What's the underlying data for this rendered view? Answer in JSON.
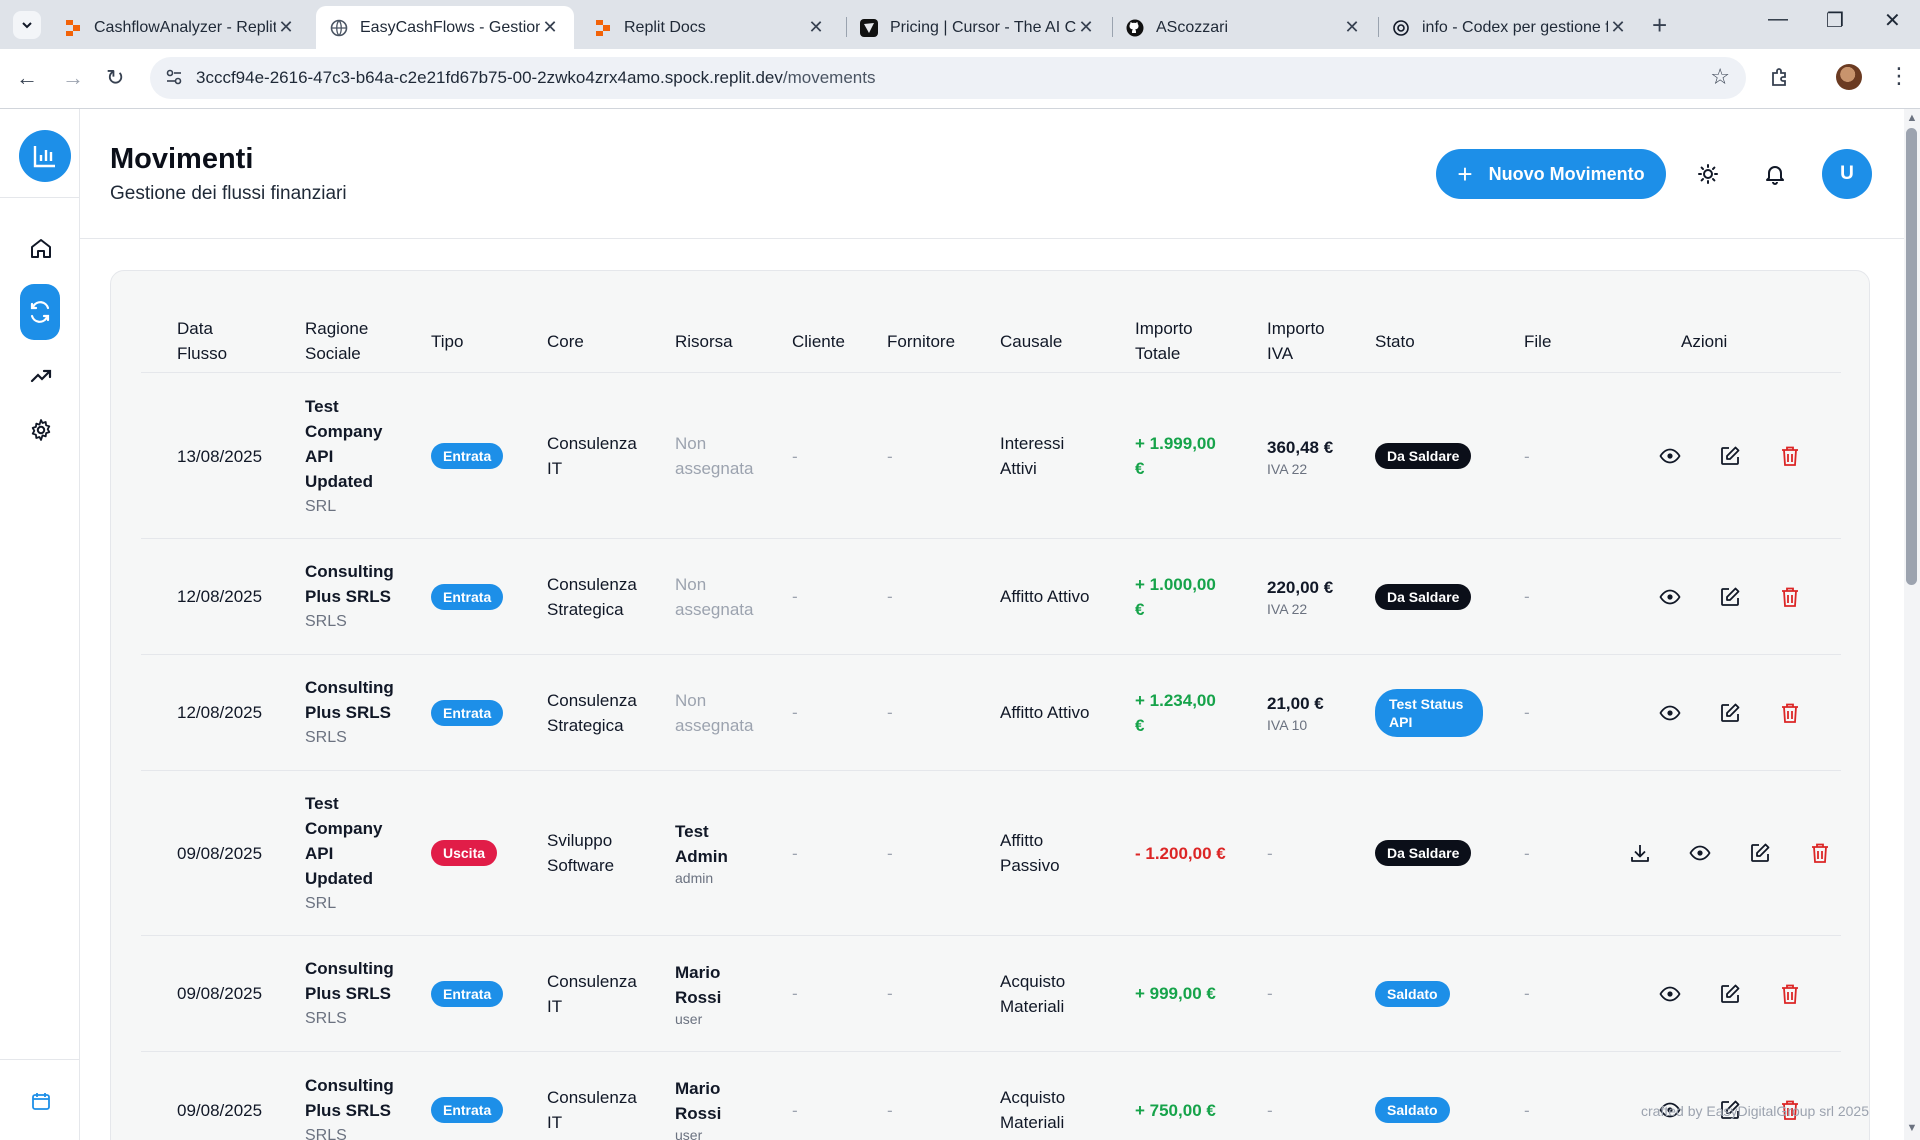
{
  "browser": {
    "tabs": [
      {
        "title": "CashflowAnalyzer - Replit",
        "icon": "replit-icon",
        "active": false
      },
      {
        "title": "EasyCashFlows - Gestione f",
        "icon": "globe-icon",
        "active": true
      },
      {
        "title": "Replit Docs",
        "icon": "replit-icon",
        "active": false
      },
      {
        "title": "Pricing | Cursor - The AI Co",
        "icon": "cursor-icon",
        "active": false
      },
      {
        "title": "AScozzari",
        "icon": "github-icon",
        "active": false
      },
      {
        "title": "info - Codex per gestione f",
        "icon": "openai-icon",
        "active": false
      }
    ],
    "url_host": "3cccf94e-2616-47c3-b64a-c2e21fd67b75-00-2zwko4zrx4amo.spock.replit.dev",
    "url_path": "/movements"
  },
  "header": {
    "title": "Movimenti",
    "subtitle": "Gestione dei flussi finanziari",
    "new_button": "Nuovo Movimento",
    "avatar_initial": "U"
  },
  "table": {
    "columns": {
      "data_flusso": "Data Flusso",
      "ragione_sociale": "Ragione Sociale",
      "tipo": "Tipo",
      "core": "Core",
      "risorsa": "Risorsa",
      "cliente": "Cliente",
      "fornitore": "Fornitore",
      "causale": "Causale",
      "importo_totale": "Importo Totale",
      "importo_iva": "Importo IVA",
      "stato": "Stato",
      "file": "File",
      "azioni": "Azioni"
    },
    "rows": [
      {
        "date": "13/08/2025",
        "company": "Test Company API Updated",
        "company_type": "SRL",
        "type": "Entrata",
        "core": "Consulenza IT",
        "resource": "Non assegnata",
        "resource_role": "",
        "cliente": "-",
        "fornitore": "-",
        "causale": "Interessi Attivi",
        "amount": "+ 1.999,00 €",
        "iva": "360,48 €",
        "iva_rate": "IVA 22",
        "status": "Da Saldare",
        "file": "-"
      },
      {
        "date": "12/08/2025",
        "company": "Consulting Plus SRLS",
        "company_type": "SRLS",
        "type": "Entrata",
        "core": "Consulenza Strategica",
        "resource": "Non assegnata",
        "resource_role": "",
        "cliente": "-",
        "fornitore": "-",
        "causale": "Affitto Attivo",
        "amount": "+ 1.000,00 €",
        "iva": "220,00 €",
        "iva_rate": "IVA 22",
        "status": "Da Saldare",
        "file": "-"
      },
      {
        "date": "12/08/2025",
        "company": "Consulting Plus SRLS",
        "company_type": "SRLS",
        "type": "Entrata",
        "core": "Consulenza Strategica",
        "resource": "Non assegnata",
        "resource_role": "",
        "cliente": "-",
        "fornitore": "-",
        "causale": "Affitto Attivo",
        "amount": "+ 1.234,00 €",
        "iva": "21,00 €",
        "iva_rate": "IVA 10",
        "status": "Test Status API",
        "file": "-"
      },
      {
        "date": "09/08/2025",
        "company": "Test Company API Updated",
        "company_type": "SRL",
        "type": "Uscita",
        "core": "Sviluppo Software",
        "resource": "Test Admin",
        "resource_role": "admin",
        "cliente": "-",
        "fornitore": "-",
        "causale": "Affitto Passivo",
        "amount": "- 1.200,00 €",
        "iva": "-",
        "iva_rate": "",
        "status": "Da Saldare",
        "file": "-"
      },
      {
        "date": "09/08/2025",
        "company": "Consulting Plus SRLS",
        "company_type": "SRLS",
        "type": "Entrata",
        "core": "Consulenza IT",
        "resource": "Mario Rossi",
        "resource_role": "user",
        "cliente": "-",
        "fornitore": "-",
        "causale": "Acquisto Materiali",
        "amount": "+ 999,00 €",
        "iva": "-",
        "iva_rate": "",
        "status": "Saldato",
        "file": "-"
      },
      {
        "date": "09/08/2025",
        "company": "Consulting Plus SRLS",
        "company_type": "SRLS",
        "type": "Entrata",
        "core": "Consulenza IT",
        "resource": "Mario Rossi",
        "resource_role": "user",
        "cliente": "-",
        "fornitore": "-",
        "causale": "Acquisto Materiali",
        "amount": "+ 750,00 €",
        "iva": "-",
        "iva_rate": "",
        "status": "Saldato",
        "file": "-"
      }
    ]
  },
  "footer": {
    "note": "crafted by EasyDigitalGroup srl 2025"
  },
  "colors": {
    "primary": "#1d8fe8",
    "positive": "#16a34a",
    "negative": "#dc2626",
    "status_dark": "#0b0f19"
  }
}
